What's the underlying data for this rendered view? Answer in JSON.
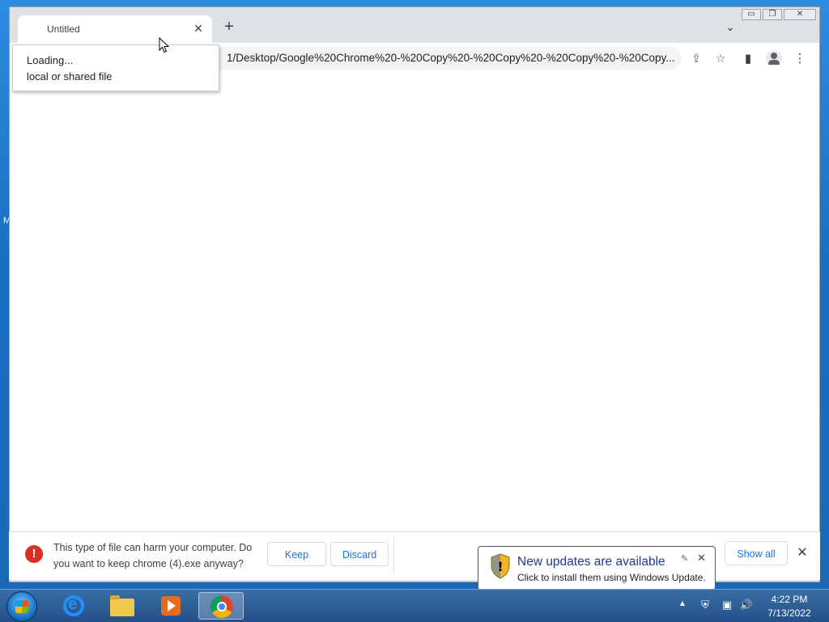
{
  "browser": {
    "tab": {
      "title": "Untitled",
      "close_glyph": "✕"
    },
    "new_tab_glyph": "+",
    "tab_search_glyph": "⌄",
    "window_controls": {
      "minimize": "▭",
      "restore": "❐",
      "close": "✕"
    },
    "address": "1/Desktop/Google%20Chrome%20-%20Copy%20-%20Copy%20-%20Copy%20-%20Copy...",
    "icons": {
      "share": "share-icon",
      "bookmark": "star-icon",
      "side_panel": "side-panel-icon",
      "profile": "profile-icon",
      "menu": "more-vert-icon"
    }
  },
  "tooltip": {
    "line1": "Loading...",
    "line2": "local or shared file"
  },
  "download_bar": {
    "warning_glyph": "!",
    "message": "This type of file can harm your computer. Do you want to keep chrome (4).exe anyway?",
    "keep_label": "Keep",
    "discard_label": "Discard",
    "show_all_label": "Show all",
    "close_glyph": "✕"
  },
  "notification": {
    "title": "New updates are available",
    "body": "Click to install them using Windows Update.",
    "options_glyph": "🔧",
    "close_glyph": "✕"
  },
  "taskbar": {
    "items": [
      "start",
      "internet-explorer",
      "windows-explorer",
      "media-player",
      "google-chrome"
    ],
    "tray_arrow": "▲",
    "clock_time": "4:22 PM",
    "clock_date": "7/13/2022"
  },
  "colors": {
    "desktop": "#1f74c4",
    "link_blue": "#1a73e8",
    "warning_red": "#d93025",
    "balloon_title": "#1e3b8a"
  }
}
